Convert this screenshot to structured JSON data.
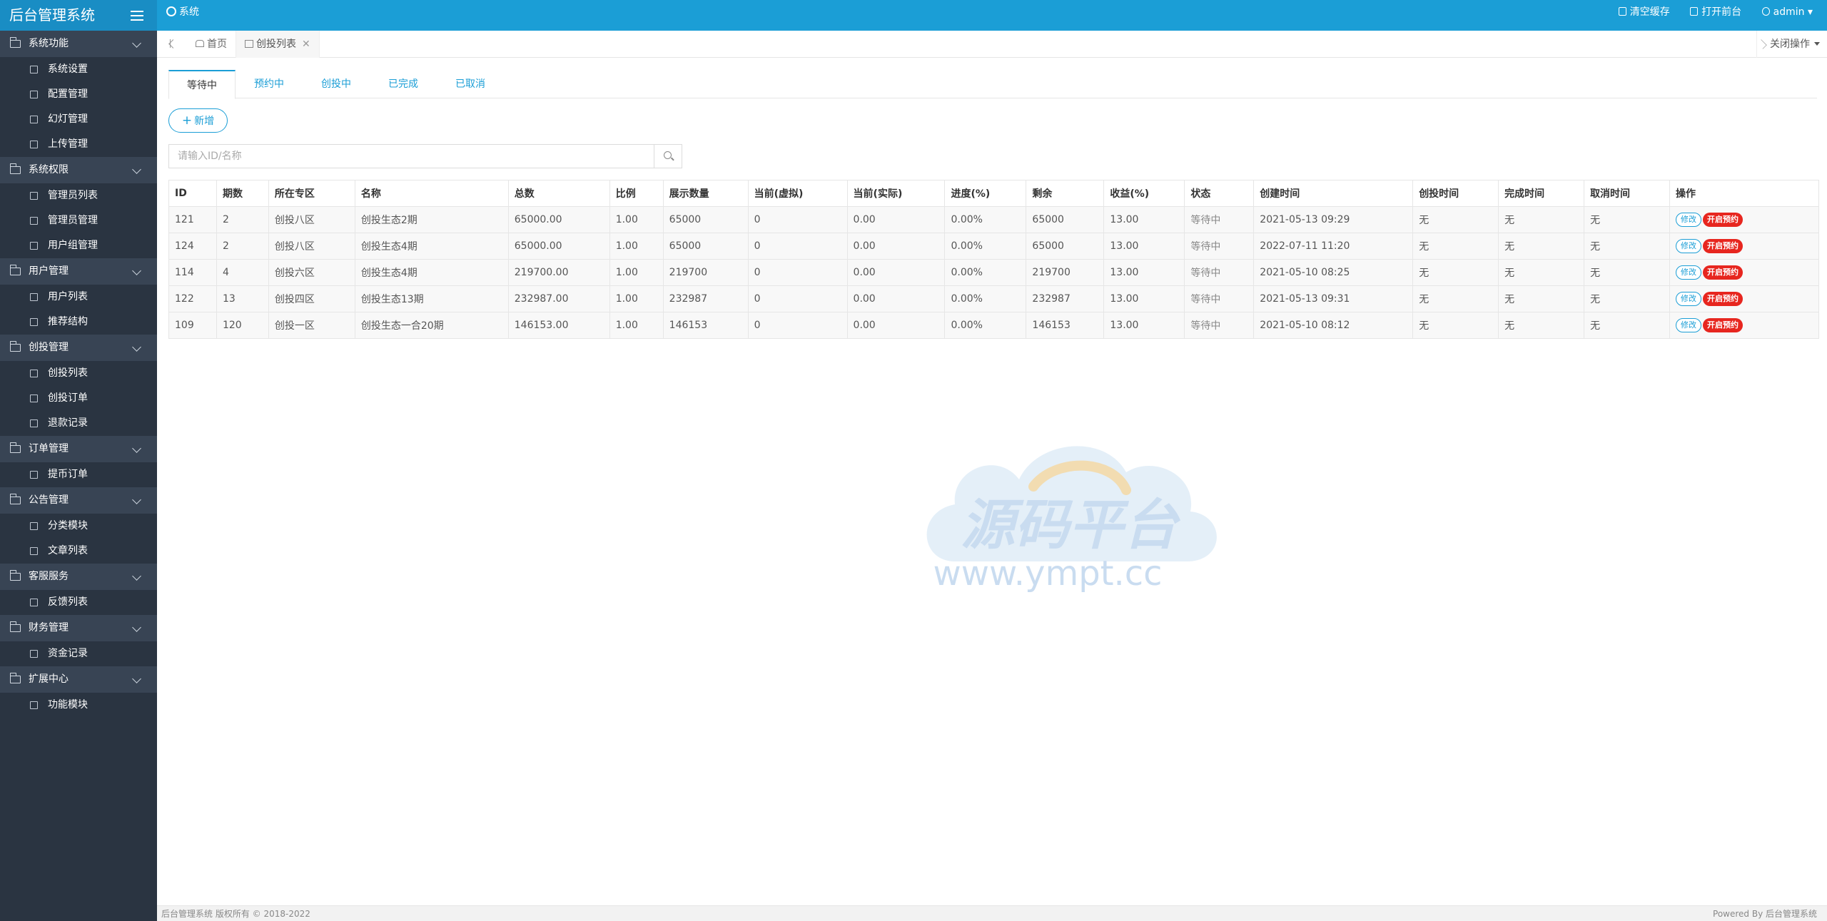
{
  "header": {
    "app_title": "后台管理系统",
    "system_label": "系统",
    "clear_cache": "清空缓存",
    "open_frontend": "打开前台",
    "user": "admin"
  },
  "sidebar": {
    "groups": [
      {
        "label": "系统功能",
        "items": [
          "系统设置",
          "配置管理",
          "幻灯管理",
          "上传管理"
        ]
      },
      {
        "label": "系统权限",
        "items": [
          "管理员列表",
          "管理员管理",
          "用户组管理"
        ]
      },
      {
        "label": "用户管理",
        "items": [
          "用户列表",
          "推荐结构"
        ]
      },
      {
        "label": "创投管理",
        "items": [
          "创投列表",
          "创投订单",
          "退款记录"
        ]
      },
      {
        "label": "订单管理",
        "items": [
          "提币订单"
        ]
      },
      {
        "label": "公告管理",
        "items": [
          "分类模块",
          "文章列表"
        ]
      },
      {
        "label": "客服服务",
        "items": [
          "反馈列表"
        ]
      },
      {
        "label": "财务管理",
        "items": [
          "资金记录"
        ]
      },
      {
        "label": "扩展中心",
        "items": [
          "功能模块"
        ]
      }
    ]
  },
  "tabbar": {
    "home": "首页",
    "active": "创投列表",
    "close_ops": "关闭操作"
  },
  "status_tabs": [
    "等待中",
    "预约中",
    "创投中",
    "已完成",
    "已取消"
  ],
  "add_button": "新增",
  "search": {
    "placeholder": "请输入ID/名称"
  },
  "table": {
    "headers": [
      "ID",
      "期数",
      "所在专区",
      "名称",
      "总数",
      "比例",
      "展示数量",
      "当前(虚拟)",
      "当前(实际)",
      "进度(%)",
      "剩余",
      "收益(%)",
      "状态",
      "创建时间",
      "创投时间",
      "完成时间",
      "取消时间",
      "操作"
    ],
    "rows": [
      [
        "121",
        "2",
        "创投八区",
        "创投生态2期",
        "65000.00",
        "1.00",
        "65000",
        "0",
        "0.00",
        "0.00%",
        "65000",
        "13.00",
        "等待中",
        "2021-05-13 09:29",
        "无",
        "无",
        "无"
      ],
      [
        "124",
        "2",
        "创投八区",
        "创投生态4期",
        "65000.00",
        "1.00",
        "65000",
        "0",
        "0.00",
        "0.00%",
        "65000",
        "13.00",
        "等待中",
        "2022-07-11 11:20",
        "无",
        "无",
        "无"
      ],
      [
        "114",
        "4",
        "创投六区",
        "创投生态4期",
        "219700.00",
        "1.00",
        "219700",
        "0",
        "0.00",
        "0.00%",
        "219700",
        "13.00",
        "等待中",
        "2021-05-10 08:25",
        "无",
        "无",
        "无"
      ],
      [
        "122",
        "13",
        "创投四区",
        "创投生态13期",
        "232987.00",
        "1.00",
        "232987",
        "0",
        "0.00",
        "0.00%",
        "232987",
        "13.00",
        "等待中",
        "2021-05-13 09:31",
        "无",
        "无",
        "无"
      ],
      [
        "109",
        "120",
        "创投一区",
        "创投生态一合20期",
        "146153.00",
        "1.00",
        "146153",
        "0",
        "0.00",
        "0.00%",
        "146153",
        "13.00",
        "等待中",
        "2021-05-10 08:12",
        "无",
        "无",
        "无"
      ]
    ],
    "op_edit": "修改",
    "op_book": "开启预约"
  },
  "watermark": {
    "title": "源码平台",
    "url": "www.ympt.cc"
  },
  "footer": {
    "left": "后台管理系统 版权所有 © 2018-2022",
    "right": "Powered By 后台管理系统"
  },
  "colors": {
    "primary": "#1b9ed6",
    "sidebar": "#2a3441",
    "danger": "#e7261f"
  }
}
